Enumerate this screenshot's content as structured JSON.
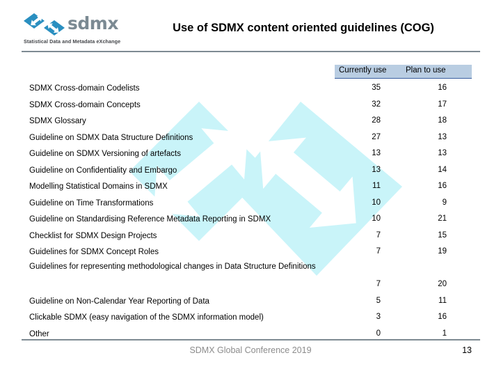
{
  "header": {
    "title": "Use of SDMX content oriented guidelines (COG)",
    "logo": {
      "wordmark": "sdmx",
      "tagline": "Statistical Data and Metadata eXchange",
      "mark_icon": "sdmx-diamond-arrow-icon"
    },
    "rule_color": "#7e8a93"
  },
  "table": {
    "columns": [
      {
        "key": "label",
        "header": ""
      },
      {
        "key": "current",
        "header": "Currently use"
      },
      {
        "key": "plan",
        "header": "Plan to use"
      }
    ],
    "header_background": "#b9cde2",
    "header_underline": "#3a5fa0",
    "rows": [
      {
        "label": "SDMX Cross-domain Codelists",
        "current": "35",
        "plan": "16",
        "tall": false
      },
      {
        "label": "SDMX Cross-domain Concepts",
        "current": "32",
        "plan": "17",
        "tall": false
      },
      {
        "label": "SDMX Glossary",
        "current": "28",
        "plan": "18",
        "tall": false
      },
      {
        "label": "Guideline on SDMX Data Structure Definitions",
        "current": "27",
        "plan": "13",
        "tall": false
      },
      {
        "label": "Guideline on SDMX Versioning of artefacts",
        "current": "13",
        "plan": "13",
        "tall": false
      },
      {
        "label": "Guideline on Confidentiality and Embargo",
        "current": "13",
        "plan": "14",
        "tall": false
      },
      {
        "label": "Modelling Statistical Domains in SDMX",
        "current": "11",
        "plan": "16",
        "tall": false
      },
      {
        "label": "Guideline on Time Transformations",
        "current": "10",
        "plan": "9",
        "tall": false
      },
      {
        "label": "Guideline on Standardising Reference Metadata Reporting in SDMX",
        "current": "10",
        "plan": "21",
        "tall": false
      },
      {
        "label": "Checklist for SDMX Design Projects",
        "current": "7",
        "plan": "15",
        "tall": false
      },
      {
        "label": "Guidelines for SDMX Concept Roles",
        "current": "7",
        "plan": "19",
        "tall": false
      },
      {
        "label": "Guidelines for representing methodological changes in Data Structure Definitions",
        "current": "7",
        "plan": "20",
        "tall": true
      },
      {
        "label": "Guideline on Non-Calendar Year Reporting of Data",
        "current": "5",
        "plan": "11",
        "tall": false
      },
      {
        "label": "Clickable SDMX (easy navigation of the SDMX information model)",
        "current": "3",
        "plan": "16",
        "tall": false
      },
      {
        "label": "Other",
        "current": "0",
        "plan": "1",
        "tall": false
      }
    ]
  },
  "footer": {
    "text": "SDMX Global Conference 2019",
    "page_number": "13"
  },
  "watermark": {
    "icon": "sdmx-diamond-arrow-watermark",
    "color": "#c9f4f9"
  }
}
